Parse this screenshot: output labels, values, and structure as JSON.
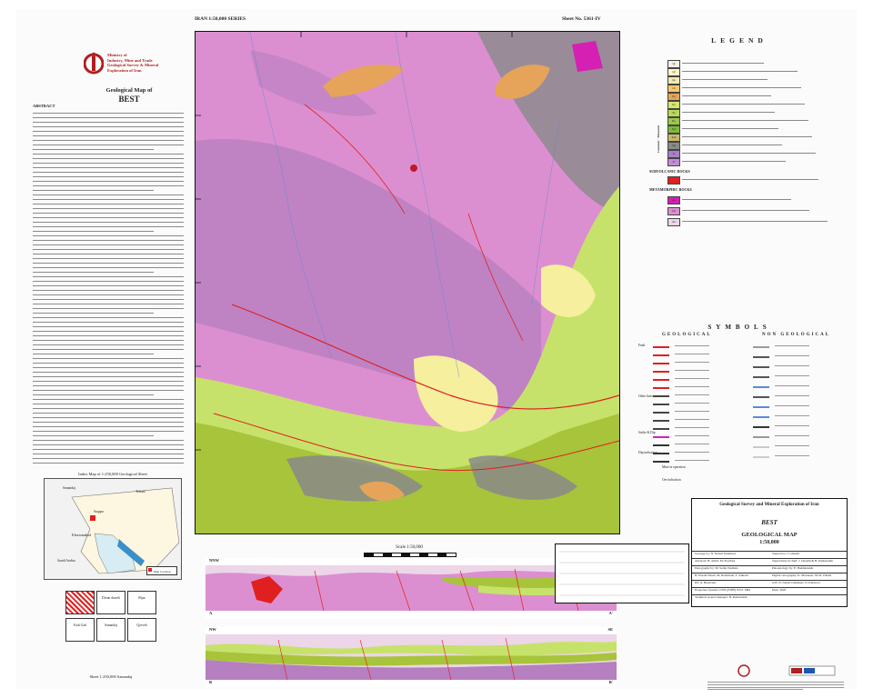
{
  "header": {
    "series": "IRAN 1:50,000 SERIES",
    "sheet_no": "Sheet No. 5361-IV"
  },
  "org": {
    "logo_lines": [
      "Ministry of",
      "Industry, Mine and Trade",
      "Geological Survey & Mineral",
      "Exploration of Iran"
    ],
    "map_title": "Geological Map of",
    "map_name": "BEST"
  },
  "abstract": {
    "heading": "ABSTRACT"
  },
  "index_map": {
    "title": "Index Map of 1:250,000 Geological Sheet",
    "places": [
      "Sanandaj",
      "Saqqez",
      "Khorramabad",
      "Tehran",
      "Saudi Arabia"
    ],
    "legend": "Map location"
  },
  "sheet_index": {
    "title": "Sheet 1:250,000 Sanandaj",
    "cells": [
      "Divan darreh",
      "Bijar",
      "Kuh Gah",
      "Sanandaj",
      "Qorveh"
    ]
  },
  "map": {
    "scale_label": "Scale 1:50,000",
    "colors": {
      "metamorphic_pink": "#dc8fd0",
      "schist_purple": "#b57fc0",
      "gray_unit": "#8a8a8a",
      "lime": "#c7e26a",
      "olive": "#a7c43a",
      "cream": "#f5ef9e",
      "orange_volcanic": "#e6a45a",
      "fault_red": "#e02020",
      "drainage_blue": "#5a8ad6"
    }
  },
  "sections": [
    {
      "left": "NNW",
      "right": "S-SE",
      "start": "A",
      "end": "A'"
    },
    {
      "left": "NW",
      "right": "SE",
      "start": "B",
      "end": "B'"
    }
  ],
  "legend": {
    "title": "LEGEND",
    "group_label": "Cenozoic · Mesozoic",
    "units": [
      {
        "code": "Qt",
        "color": "#f4f0e2"
      },
      {
        "code": "Qf",
        "color": "#fff6c8"
      },
      {
        "code": "Qa",
        "color": "#f2eab2"
      },
      {
        "code": "Ol",
        "color": "#f7c86b"
      },
      {
        "code": "Eg",
        "color": "#e6a45a"
      },
      {
        "code": "Ks",
        "color": "#d5e86e"
      },
      {
        "code": "Kl",
        "color": "#b9d85a"
      },
      {
        "code": "Kv",
        "color": "#99c94a"
      },
      {
        "code": "Kd",
        "color": "#7fb83a"
      },
      {
        "code": "Ksh",
        "color": "#c9b86b"
      },
      {
        "code": "Jsh",
        "color": "#8a8a8a"
      },
      {
        "code": "Jl",
        "color": "#a97fc7"
      },
      {
        "code": "Tr",
        "color": "#c38bd4"
      }
    ],
    "subvolcanic_heading": "SUBVOLCANIC ROCKS",
    "metamorphic_heading": "METAMORPHIC ROCKS",
    "metamorphic_units": [
      {
        "code": "gn",
        "color": "#d61fb3"
      },
      {
        "code": "sch",
        "color": "#dc8fd0"
      },
      {
        "code": "ms",
        "color": "#ecd6e8"
      }
    ]
  },
  "symbols": {
    "title": "SYMBOLS",
    "geological": "GEOLOGICAL",
    "non_geological": "NON GEOLOGICAL",
    "fault_label": "Fault",
    "other_label": "Other lines",
    "strike_label": "Strike & Dip",
    "dip_label": "Dip indication",
    "mine_label": "Mine in operation",
    "ore_label": "Ore indication"
  },
  "title_block": {
    "org": "Geological Survey and Mineral Exploration of Iran",
    "name": "BEST",
    "type": "GEOLOGICAL MAP",
    "scale": "1:50,000"
  },
  "credits": {
    "rows": [
      [
        "Geology by: N. Nabati Ghamsari",
        "Supervisor: J. Ghasmi"
      ],
      [
        "Advisors: H. Amiri, M. Pourbasi",
        "Supervision in chief: J. Ghasmi & B. Pashazadeh"
      ],
      [
        "Petrography by: M. Seifer Nadhale",
        "Paleontology by: E. Baddalzadeh"
      ],
      [
        "H. Ensani Nasab, M. Roshiiraie, L. Alkram",
        "Digital cartography: K. Montazer, M.-R. Zahabi"
      ],
      [
        "RS: A. Beratvani",
        "GIS: N. Nabati Ghamsari, N. Khosravi"
      ],
      [
        "Projection System: UTM (Z38N) WGS 1984",
        "Date: 2018"
      ],
      [
        "Technical project manager: B. Pashazadeh",
        ""
      ]
    ]
  }
}
